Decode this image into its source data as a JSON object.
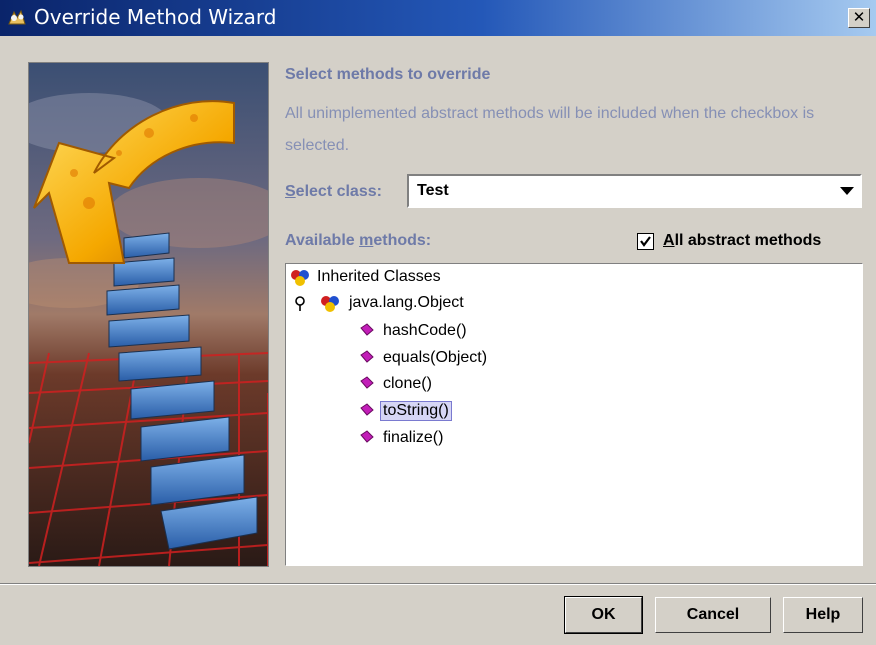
{
  "window": {
    "title": "Override Method Wizard",
    "close_glyph": "✕"
  },
  "heading": "Select methods to override",
  "description": "All unimplemented abstract methods will be included when the checkbox is selected.",
  "select_class": {
    "label_mnemonic": "S",
    "label_rest": "elect class:",
    "value": "Test"
  },
  "available_methods": {
    "label_pre": "Available ",
    "label_mnemonic": "m",
    "label_post": "ethods:"
  },
  "all_abstract": {
    "checked": true,
    "label_mnemonic": "A",
    "label_rest": "ll abstract methods"
  },
  "tree": {
    "root": "Inherited Classes",
    "class_node": "java.lang.Object",
    "methods": [
      "hashCode()",
      "equals(Object)",
      "clone()",
      "toString()",
      "finalize()"
    ],
    "selected": "toString()"
  },
  "buttons": {
    "ok": "OK",
    "cancel": "Cancel",
    "help": "Help"
  },
  "colors": {
    "title_bar": "#0a246a",
    "label": "#6e7aa8",
    "selection": "#d6d6f5",
    "method_icon": "#c21eb8"
  }
}
